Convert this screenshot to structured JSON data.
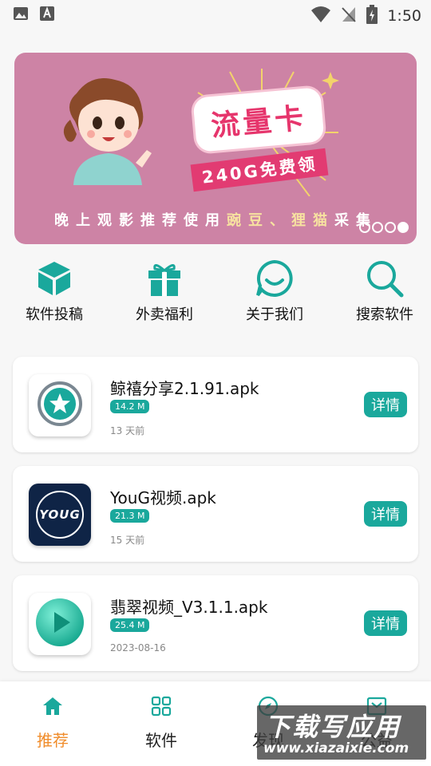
{
  "status_bar": {
    "time": "1:50"
  },
  "banner": {
    "title": "流量卡",
    "subtitle": "240G免费领",
    "caption_prefix": "晚上观影推荐使用",
    "caption_highlight": "豌豆、狸猫",
    "caption_suffix": "采集",
    "colors": {
      "background": "#cd83a5",
      "title": "#e6356c",
      "ribbon": "#e23b72"
    },
    "pager": {
      "total": 4,
      "active_index": 3
    }
  },
  "quick_nav": [
    {
      "label": "软件投稿",
      "icon": "cube-icon"
    },
    {
      "label": "外卖福利",
      "icon": "gift-icon"
    },
    {
      "label": "关于我们",
      "icon": "chat-smile-icon"
    },
    {
      "label": "搜索软件",
      "icon": "search-icon"
    }
  ],
  "apps": [
    {
      "name": "鲸禧分享2.1.91.apk",
      "size": "14.2 M",
      "time": "13 天前",
      "detail": "详情",
      "icon": "star-circle-icon"
    },
    {
      "name": "YouG视频.apk",
      "size": "21.3 M",
      "time": "15 天前",
      "detail": "详情",
      "icon": "youg-logo-icon",
      "icon_text": "YOUG"
    },
    {
      "name": "翡翠视频_V3.1.1.apk",
      "size": "25.4 M",
      "time": "2023-08-16",
      "detail": "详情",
      "icon": "play-gem-icon"
    }
  ],
  "tabs": [
    {
      "label": "推荐",
      "icon": "home-icon",
      "active": true
    },
    {
      "label": "软件",
      "icon": "grid-icon",
      "active": false
    },
    {
      "label": "发现",
      "icon": "compass-icon",
      "active": false
    },
    {
      "label": "公益",
      "icon": "box-icon",
      "active": false
    }
  ],
  "watermark": {
    "title": "下载写应用",
    "url": "www.xiazaixie.com"
  },
  "theme": {
    "accent": "#1aa89c",
    "active_tab": "#f08c2a"
  }
}
